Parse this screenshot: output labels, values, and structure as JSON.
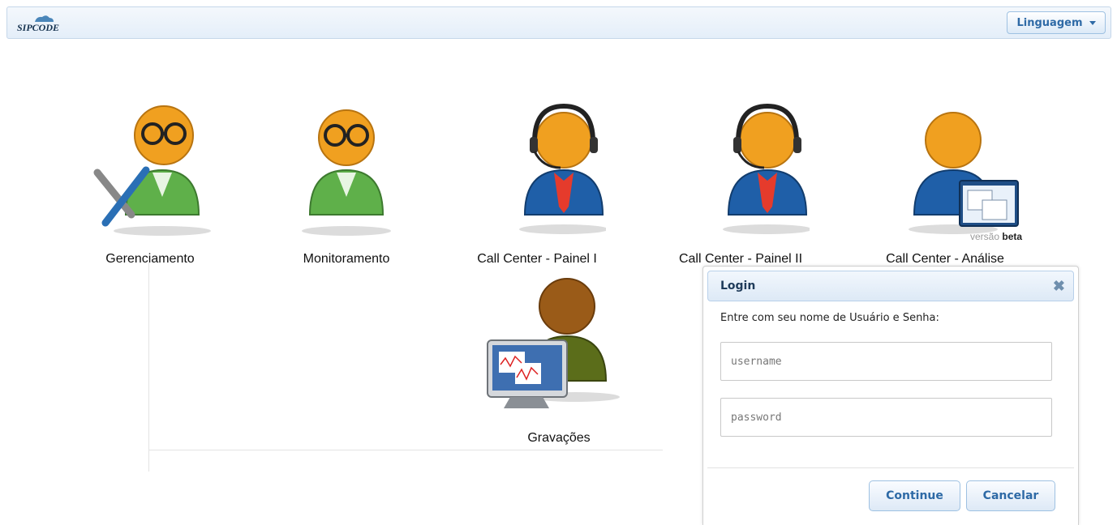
{
  "header": {
    "logo_text": "SIPCODE",
    "language_label": "Linguagem"
  },
  "apps": [
    {
      "label": "Gerenciamento",
      "icon": "manager-wrench-icon"
    },
    {
      "label": "Monitoramento",
      "icon": "monitor-user-icon"
    },
    {
      "label": "Call Center - Painel I",
      "icon": "agent-headset-icon"
    },
    {
      "label": "Call Center - Painel II",
      "icon": "agent-headset-icon"
    },
    {
      "label": "Call Center - Análise",
      "icon": "analysis-window-icon",
      "badge_prefix": "versão",
      "badge_strong": "beta"
    },
    {
      "label": "Gravações",
      "icon": "recordings-screen-icon"
    }
  ],
  "login_dialog": {
    "title": "Login",
    "message": "Entre com seu nome de Usuário e Senha:",
    "username_placeholder": "username",
    "password_placeholder": "password",
    "continue_label": "Continue",
    "cancel_label": "Cancelar"
  },
  "colors": {
    "accent": "#2e6aa6",
    "header_bg": "#e4eef9"
  }
}
